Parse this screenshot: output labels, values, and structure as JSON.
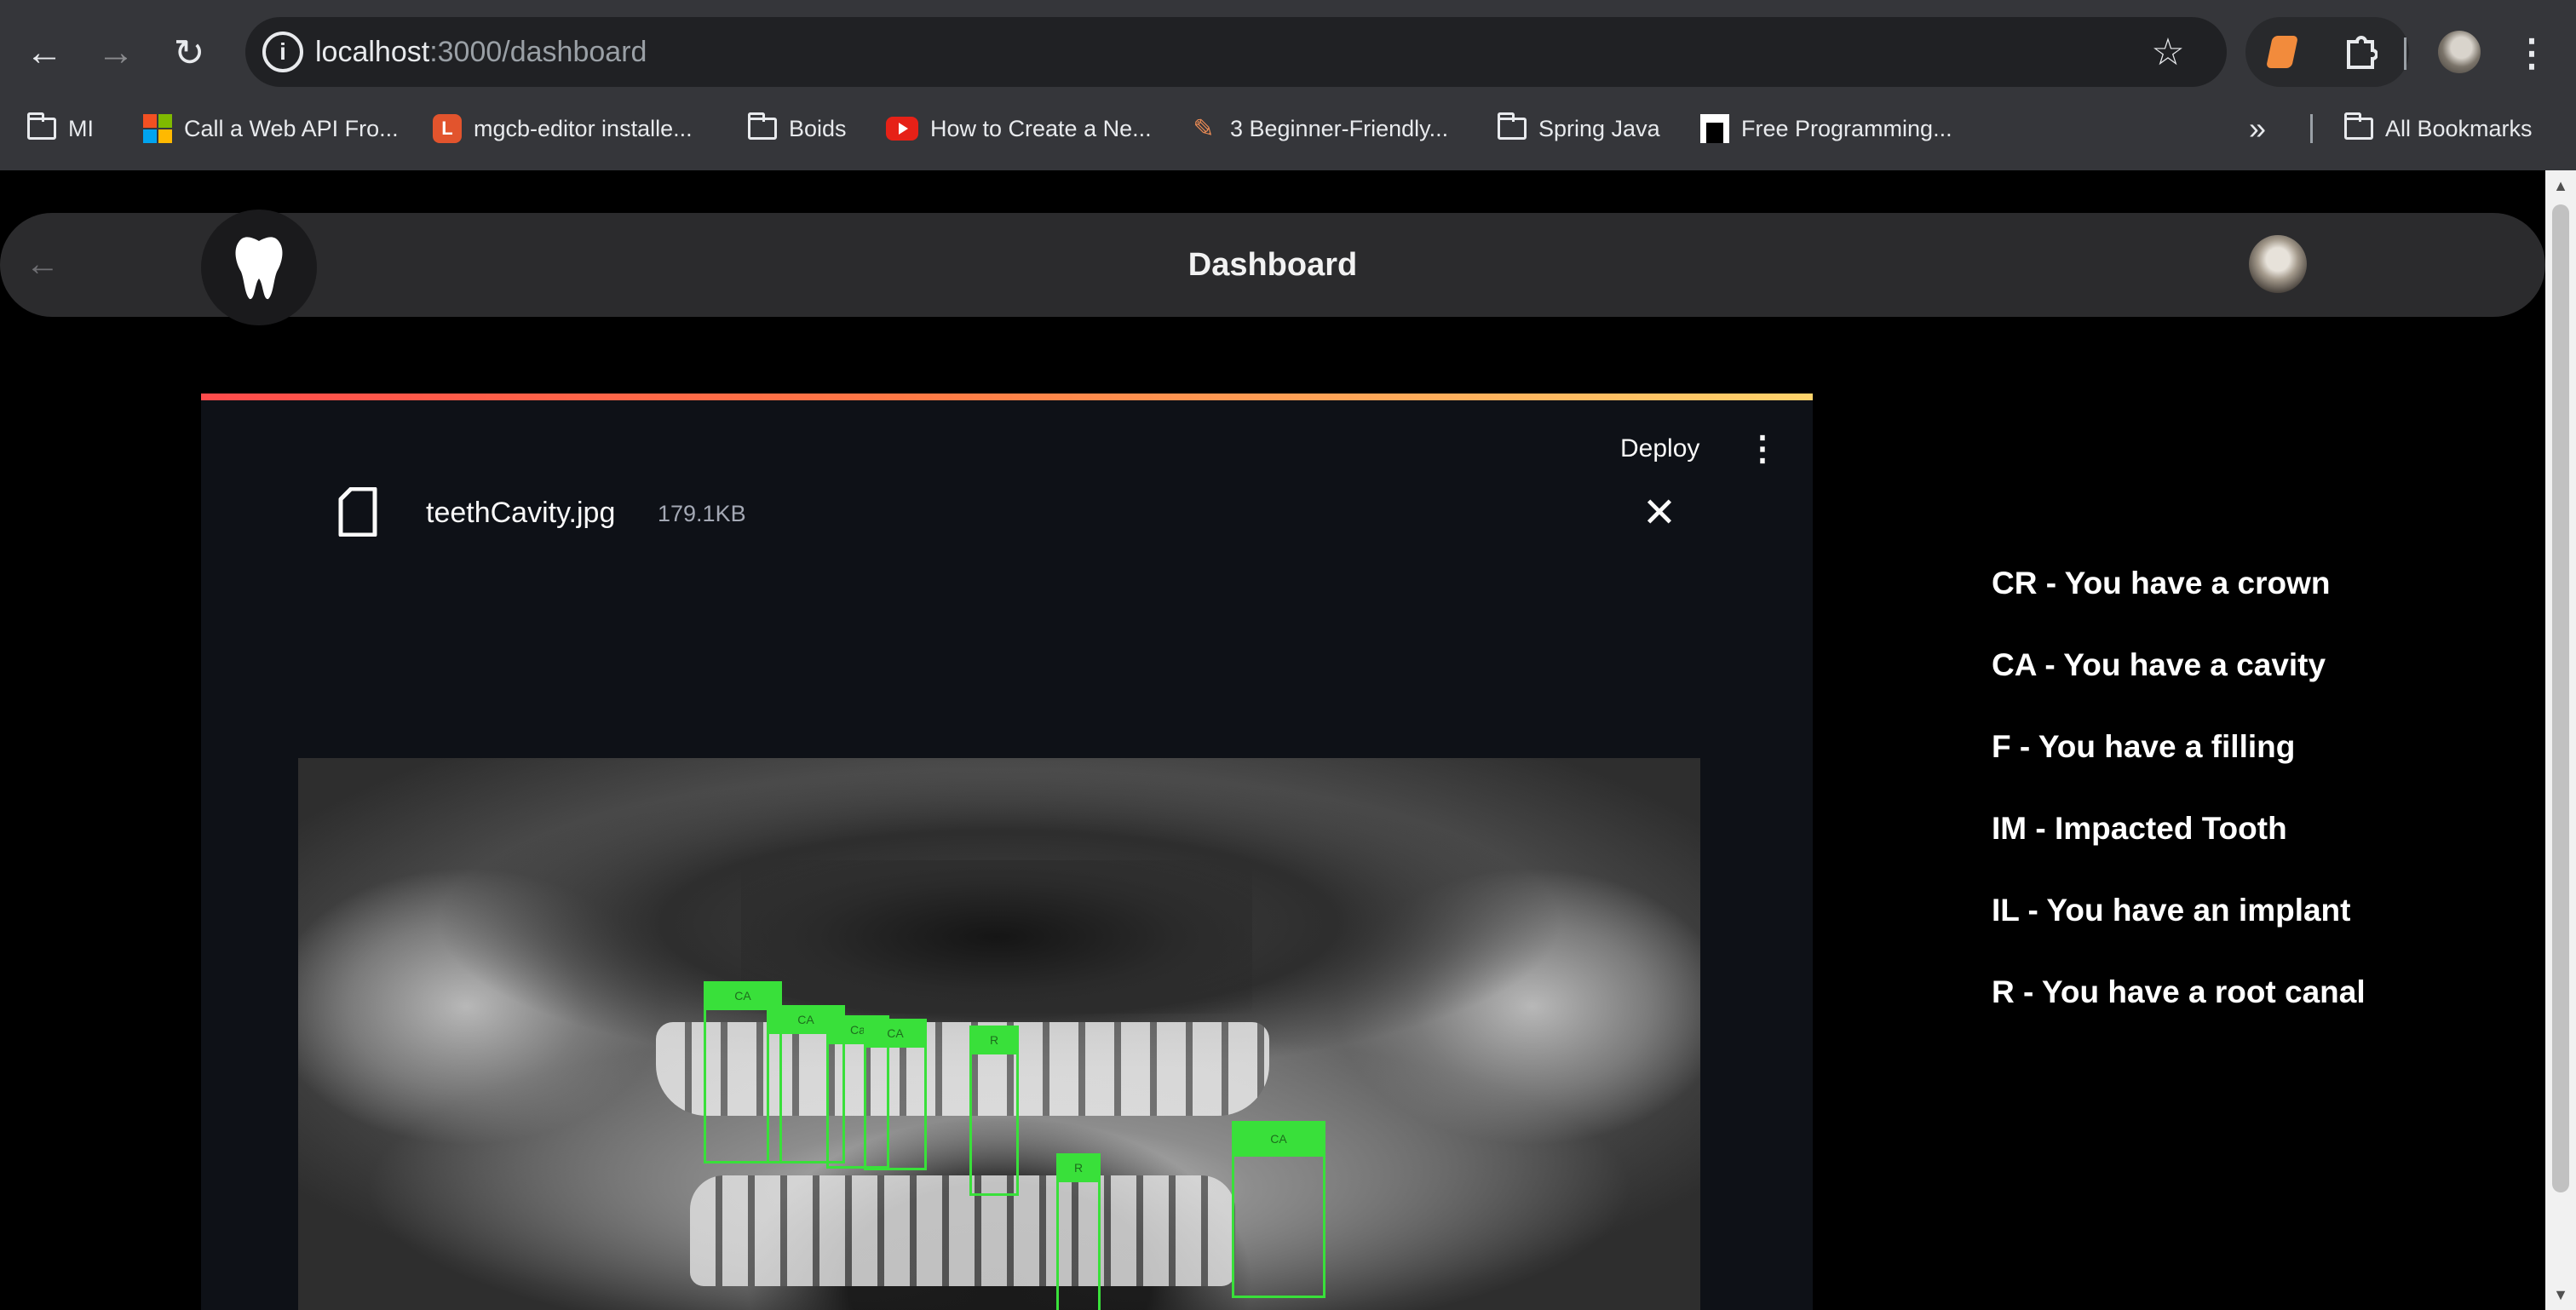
{
  "browser": {
    "url_host": "localhost",
    "url_path": ":3000/dashboard",
    "bookmarks": [
      {
        "label": "MI",
        "icon": "folder-icon"
      },
      {
        "label": "Call a Web API Fro...",
        "icon": "microsoft-icon"
      },
      {
        "label": "mgcb-editor installe...",
        "icon": "mgcb-icon"
      },
      {
        "label": "Boids",
        "icon": "folder-icon"
      },
      {
        "label": "How to Create a Ne...",
        "icon": "youtube-icon"
      },
      {
        "label": "3 Beginner-Friendly...",
        "icon": "pen-icon"
      },
      {
        "label": "Spring Java",
        "icon": "folder-icon"
      },
      {
        "label": "Free Programming...",
        "icon": "site-icon"
      }
    ],
    "more_bookmarks": "»",
    "all_bookmarks": "All Bookmarks"
  },
  "app": {
    "title": "Dashboard",
    "deploy_label": "Deploy",
    "file": {
      "name": "teethCavity.jpg",
      "size": "179.1KB"
    },
    "detections": [
      {
        "label": "CA"
      },
      {
        "label": "CA"
      },
      {
        "label": "Ca"
      },
      {
        "label": "CA"
      },
      {
        "label": "R"
      },
      {
        "label": "R"
      },
      {
        "label": "CA"
      }
    ],
    "legend": [
      "CR - You have a crown",
      "CA - You have a cavity",
      "F - You have a filling",
      "IM - Impacted Tooth",
      "IL - You have an implant",
      "R - You have a root canal"
    ]
  },
  "colors": {
    "detection_box": "#39e03a",
    "header_bar": "#2b2b2d",
    "frame_accent_start": "#ff4b4b",
    "frame_accent_end": "#ffd36b"
  }
}
